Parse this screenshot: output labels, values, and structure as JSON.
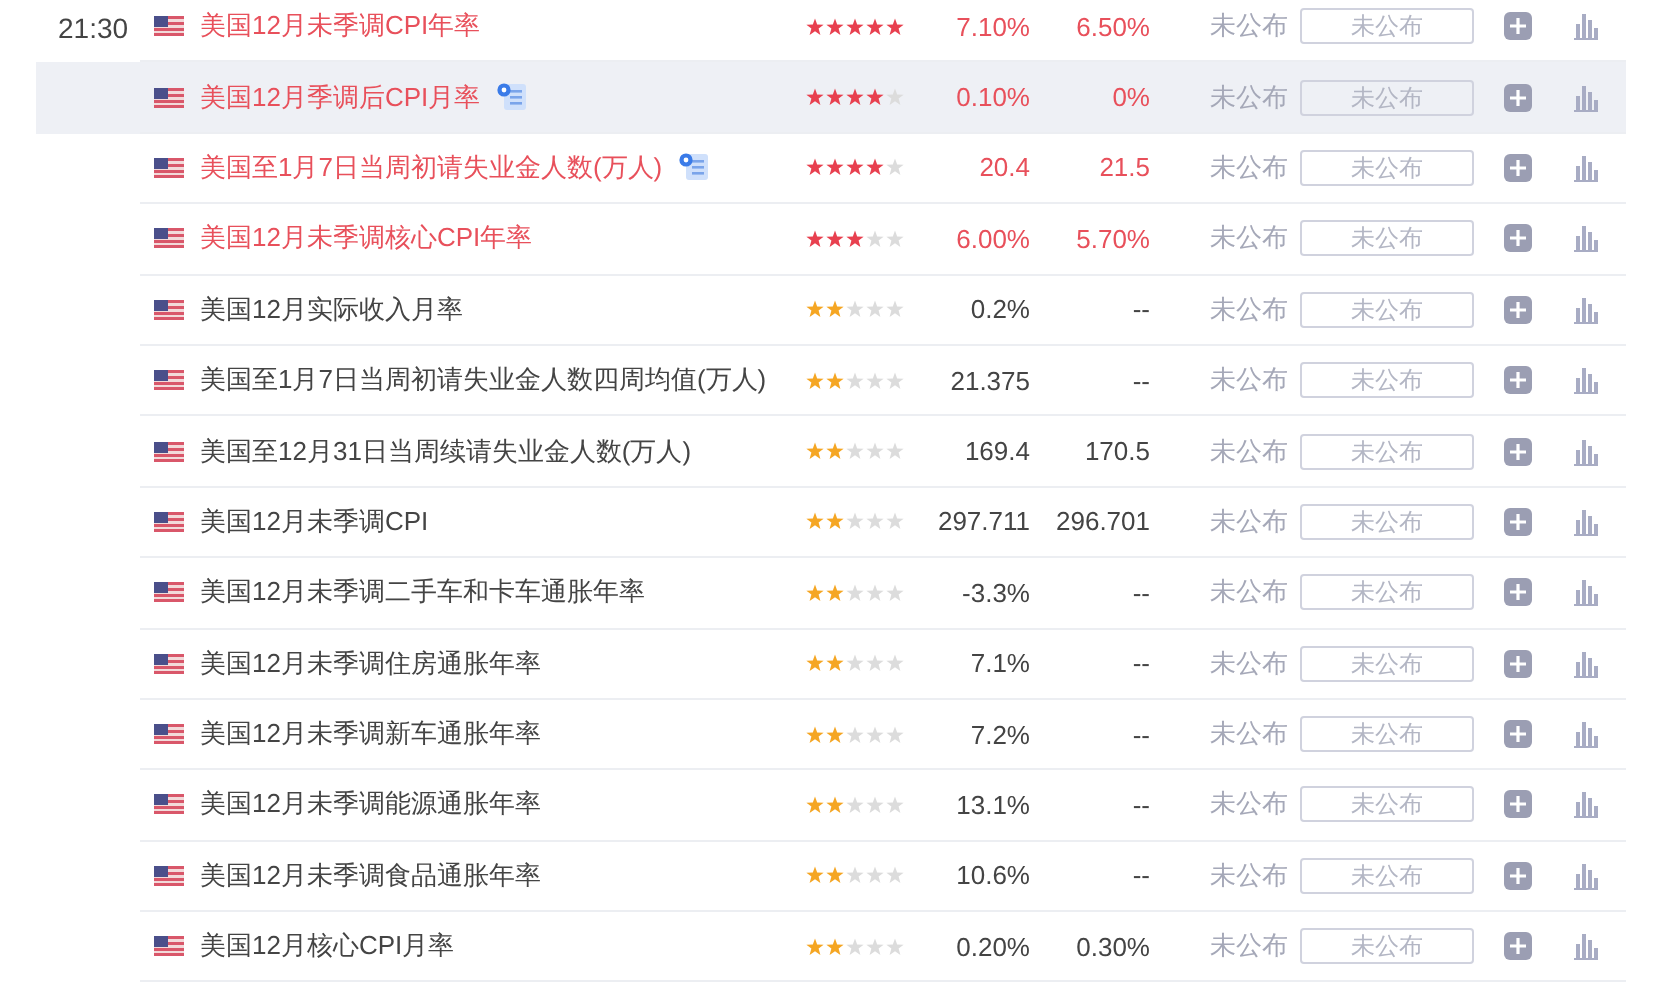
{
  "rows": [
    {
      "time": "21:30",
      "name": "美国12月未季调CPI年率",
      "note": false,
      "selected": false,
      "stars": 5,
      "previous": "7.10%",
      "forecast": "6.50%",
      "actual": "未公布",
      "entry": {
        "placeholder": "未公布"
      }
    },
    {
      "name": "美国12月季调后CPI月率",
      "note": true,
      "selected": true,
      "stars": 4,
      "previous": "0.10%",
      "forecast": "0%",
      "actual": "未公布",
      "entry": {
        "placeholder": "未公布"
      }
    },
    {
      "name": "美国至1月7日当周初请失业金人数(万人)",
      "note": true,
      "selected": false,
      "stars": 4,
      "previous": "20.4",
      "forecast": "21.5",
      "actual": "未公布",
      "entry": {
        "placeholder": "未公布"
      }
    },
    {
      "name": "美国12月未季调核心CPI年率",
      "note": false,
      "selected": false,
      "stars": 3,
      "previous": "6.00%",
      "forecast": "5.70%",
      "actual": "未公布",
      "entry": {
        "placeholder": "未公布"
      }
    },
    {
      "name": "美国12月实际收入月率",
      "note": false,
      "selected": false,
      "stars": 2,
      "previous": "0.2%",
      "forecast": "--",
      "actual": "未公布",
      "entry": {
        "placeholder": "未公布"
      }
    },
    {
      "name": "美国至1月7日当周初请失业金人数四周均值(万人)",
      "note": false,
      "selected": false,
      "stars": 2,
      "previous": "21.375",
      "forecast": "--",
      "actual": "未公布",
      "entry": {
        "placeholder": "未公布"
      }
    },
    {
      "name": "美国至12月31日当周续请失业金人数(万人)",
      "note": false,
      "selected": false,
      "stars": 2,
      "previous": "169.4",
      "forecast": "170.5",
      "actual": "未公布",
      "entry": {
        "placeholder": "未公布"
      }
    },
    {
      "name": "美国12月未季调CPI",
      "note": false,
      "selected": false,
      "stars": 2,
      "previous": "297.711",
      "forecast": "296.701",
      "actual": "未公布",
      "entry": {
        "placeholder": "未公布"
      }
    },
    {
      "name": "美国12月未季调二手车和卡车通胀年率",
      "note": false,
      "selected": false,
      "stars": 2,
      "previous": "-3.3%",
      "forecast": "--",
      "actual": "未公布",
      "entry": {
        "placeholder": "未公布"
      }
    },
    {
      "name": "美国12月未季调住房通胀年率",
      "note": false,
      "selected": false,
      "stars": 2,
      "previous": "7.1%",
      "forecast": "--",
      "actual": "未公布",
      "entry": {
        "placeholder": "未公布"
      }
    },
    {
      "name": "美国12月未季调新车通胀年率",
      "note": false,
      "selected": false,
      "stars": 2,
      "previous": "7.2%",
      "forecast": "--",
      "actual": "未公布",
      "entry": {
        "placeholder": "未公布"
      }
    },
    {
      "name": "美国12月未季调能源通胀年率",
      "note": false,
      "selected": false,
      "stars": 2,
      "previous": "13.1%",
      "forecast": "--",
      "actual": "未公布",
      "entry": {
        "placeholder": "未公布"
      }
    },
    {
      "name": "美国12月未季调食品通胀年率",
      "note": false,
      "selected": false,
      "stars": 2,
      "previous": "10.6%",
      "forecast": "--",
      "actual": "未公布",
      "entry": {
        "placeholder": "未公布"
      }
    },
    {
      "name": "美国12月核心CPI月率",
      "note": false,
      "selected": false,
      "stars": 2,
      "previous": "0.20%",
      "forecast": "0.30%",
      "actual": "未公布",
      "entry": {
        "placeholder": "未公布"
      }
    }
  ]
}
